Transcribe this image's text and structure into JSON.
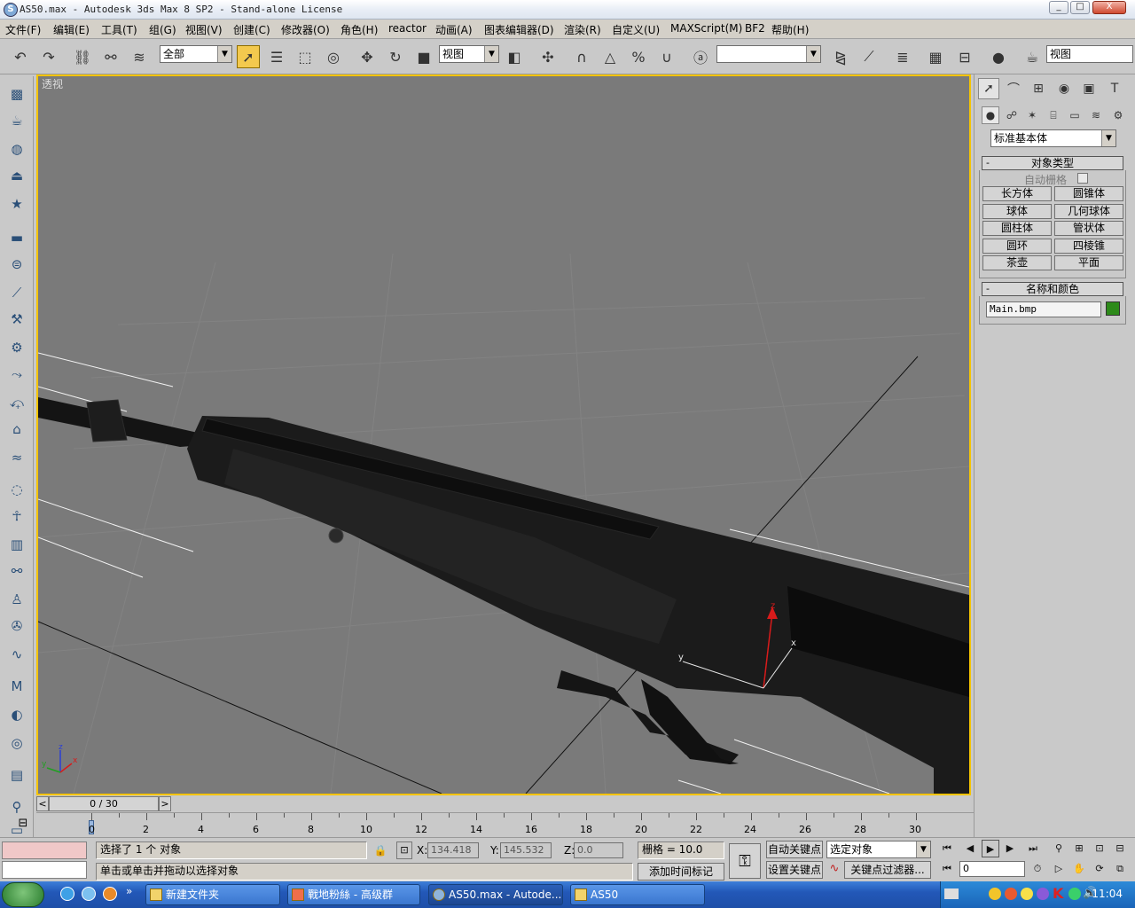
{
  "window": {
    "title": "AS50.max - Autodesk 3ds Max 8 SP2  - Stand-alone License",
    "icon": "3ds-max-icon",
    "controls": [
      "_",
      "□",
      "X"
    ]
  },
  "menu": {
    "items": [
      "文件(F)",
      "编辑(E)",
      "工具(T)",
      "组(G)",
      "视图(V)",
      "创建(C)",
      "修改器(O)",
      "角色(H)",
      "reactor",
      "动画(A)",
      "图表编辑器(D)",
      "渲染(R)",
      "自定义(U)",
      "MAXScript(M)",
      "BF2",
      "帮助(H)"
    ]
  },
  "toolbar": {
    "selection_filter": "全部",
    "ref_coord": "视图",
    "named_selection": "",
    "right_view": "视图"
  },
  "viewport": {
    "label": "透视",
    "gizmo": {
      "x": "x",
      "y": "y",
      "z": "z"
    },
    "axis_tripod": {
      "x": "x",
      "y": "y",
      "z": "z"
    }
  },
  "command_panel": {
    "category": "标准基本体",
    "object_type": {
      "header": "对象类型",
      "autogrid_label": "自动栅格",
      "buttons": [
        "长方体",
        "圆锥体",
        "球体",
        "几何球体",
        "圆柱体",
        "管状体",
        "圆环",
        "四棱锥",
        "茶壶",
        "平面"
      ]
    },
    "name_color": {
      "header": "名称和颜色",
      "name_value": "Main.bmp",
      "color": "#2d8a1a"
    }
  },
  "time_slider": {
    "value": "0 / 30",
    "prev": "<",
    "next": ">"
  },
  "track": {
    "labels": [
      "0",
      "2",
      "4",
      "6",
      "8",
      "10",
      "12",
      "14",
      "16",
      "18",
      "20",
      "22",
      "24",
      "26",
      "28",
      "30"
    ]
  },
  "status": {
    "selection_text": "选择了 1 个 对象",
    "prompt_text": "单击或单击并拖动以选择对象",
    "x_label": "X:",
    "x_value": "134.418",
    "y_label": "Y:",
    "y_value": "145.532",
    "z_label": "Z:",
    "z_value": "0.0",
    "grid": "栅格 = 10.0",
    "add_time_tag": "添加时间标记",
    "auto_key": "自动关键点",
    "set_key": "设置关键点",
    "key_mode": "选定对象",
    "key_filters": "关键点过滤器...",
    "frame": "0"
  },
  "taskbar": {
    "tasks": [
      "新建文件夹",
      "戰地粉絲 - 高级群",
      "AS50.max - Autode...",
      "AS50"
    ],
    "clock": "11:04"
  },
  "colors": {
    "viewport_bg": "#7a7a7a",
    "active_border": "#f5c400",
    "panel_bg": "#c9c9c9"
  }
}
